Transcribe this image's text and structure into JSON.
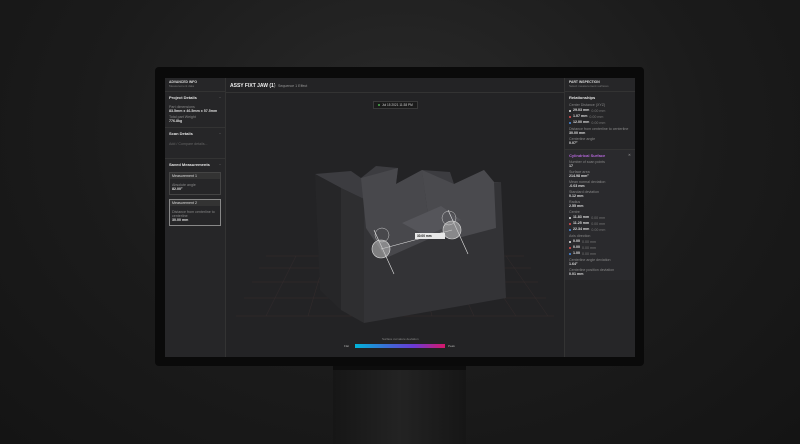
{
  "left": {
    "app_name": "ADVANCED INFO",
    "app_sub": "Measurement data",
    "project": {
      "title": "Project Details",
      "dim_label": "Part dimensions",
      "dim_value": "83.5mm x 46.5mm x 57.5mm",
      "weight_label": "Total part Weight",
      "weight_value": "776.8kg"
    },
    "scan": {
      "title": "Scan Details",
      "hint": "Add / Compare details..."
    },
    "saved": {
      "title": "Saved Measurements",
      "m1": {
        "title": "Measurement 1",
        "label": "Absolute angle",
        "value": "82.00°"
      },
      "m2": {
        "title": "Measurement 2",
        "label": "Distance from centerline to centerline",
        "value": "30.00 mm"
      }
    }
  },
  "top": {
    "title": "ASSY FIXT JAW (1)",
    "sub": "Sequence 1 Effect"
  },
  "badge": "Jul 15 2021 11:38 PM",
  "measure_label": "30.00 mm",
  "colorbar": {
    "label": "Surface curvature deviation",
    "min": "Flat",
    "max": "Peak"
  },
  "right": {
    "head": "PART INSPECTION",
    "head_sub": "Select measurement surfaces",
    "relationships": {
      "title": "Relationships",
      "dist_label": "Center Distance (XYZ)",
      "rows": [
        {
          "color": "#e0e0e0",
          "value": "29.03 mm",
          "note": "0.00 mm"
        },
        {
          "color": "#e05050",
          "value": "1.07 mm",
          "note": "0.00 mm"
        },
        {
          "color": "#4a8de0",
          "value": "12.00 mm",
          "note": "0.00 mm"
        }
      ],
      "c2c_label": "Distance from centerline to centerline",
      "c2c_value": "30.00 mm",
      "angle_label": "Centerline angle",
      "angle_value": "0.07°"
    },
    "cyl": {
      "title": "Cylindrical Surface",
      "pts_label": "Number of scan points",
      "pts_value": "17",
      "area_label": "Surface area",
      "area_value": "214.98 mm²",
      "mean_label": "Mean normal deviation",
      "mean_value": "-0.03 mm",
      "std_label": "Standard deviation",
      "std_value": "0.12 mm",
      "rad_label": "Radius",
      "rad_value": "2.55 mm",
      "cen_label": "Centre",
      "cen_rows": [
        {
          "color": "#e0e0e0",
          "value": "11.83 mm",
          "note": "0.00 mm"
        },
        {
          "color": "#e05050",
          "value": "11.25 mm",
          "note": "0.00 mm"
        },
        {
          "color": "#4a8de0",
          "value": "22.34 mm",
          "note": "0.00 mm"
        }
      ],
      "axis_label": "Axis direction",
      "axis_rows": [
        {
          "color": "#e0e0e0",
          "value": "0.00",
          "note": "0.00 mm"
        },
        {
          "color": "#e05050",
          "value": "0.00",
          "note": "0.00 mm"
        },
        {
          "color": "#4a8de0",
          "value": "1.00",
          "note": "0.00 mm"
        }
      ],
      "cang_label": "Centerline angle deviation",
      "cang_value": "1.64°",
      "cpos_label": "Centerline position deviation",
      "cpos_value": "0.01 mm"
    }
  }
}
